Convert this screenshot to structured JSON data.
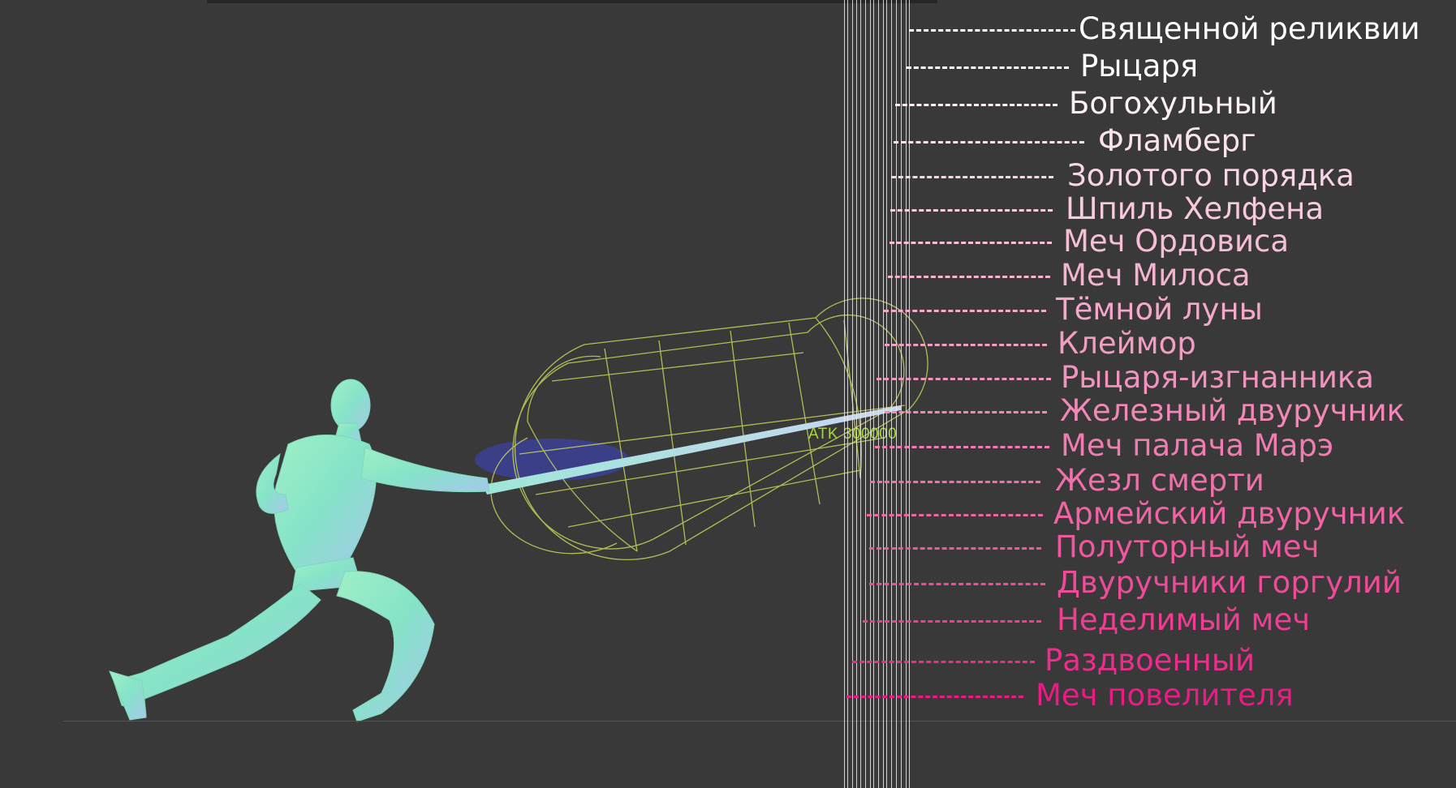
{
  "viewport": {
    "atk_label": "ATK 300000"
  },
  "colors": {
    "background": "#393939",
    "hitbox": "#c8d45a",
    "figure": "#8fe8c0",
    "reference_lines": "#ebebeb"
  },
  "weapons": [
    {
      "name": "Священной реликвии",
      "color": "#ffffff"
    },
    {
      "name": "Рыцаря",
      "color": "#ffffff"
    },
    {
      "name": "Богохульный",
      "color": "#fdf1f6"
    },
    {
      "name": "Фламберг",
      "color": "#fbe3ee"
    },
    {
      "name": "Золотого порядка",
      "color": "#f9d6e7"
    },
    {
      "name": "Шпиль Хелфена",
      "color": "#f8cadf"
    },
    {
      "name": "Меч Ордовиса",
      "color": "#f6bed8"
    },
    {
      "name": "Меч Милоса",
      "color": "#f5b3d1"
    },
    {
      "name": "Тёмной луны",
      "color": "#f4a8cb"
    },
    {
      "name": "Клеймор",
      "color": "#f39dc4"
    },
    {
      "name": "Рыцаря-изгнанника",
      "color": "#f292be"
    },
    {
      "name": "Железный двуручник",
      "color": "#f287b8"
    },
    {
      "name": "Меч палача Марэ",
      "color": "#f17cb2"
    },
    {
      "name": "Жезл смерти",
      "color": "#f070ab"
    },
    {
      "name": "Армейский двуручник",
      "color": "#f064a5"
    },
    {
      "name": "Полуторный меч",
      "color": "#ef589f"
    },
    {
      "name": "Двуручники горгулий",
      "color": "#ee4b98"
    },
    {
      "name": "Неделимый меч",
      "color": "#ee3e92"
    },
    {
      "name": "Раздвоенный",
      "color": "#ed2d8b"
    },
    {
      "name": "Меч повелителя",
      "color": "#ec1a84"
    }
  ]
}
